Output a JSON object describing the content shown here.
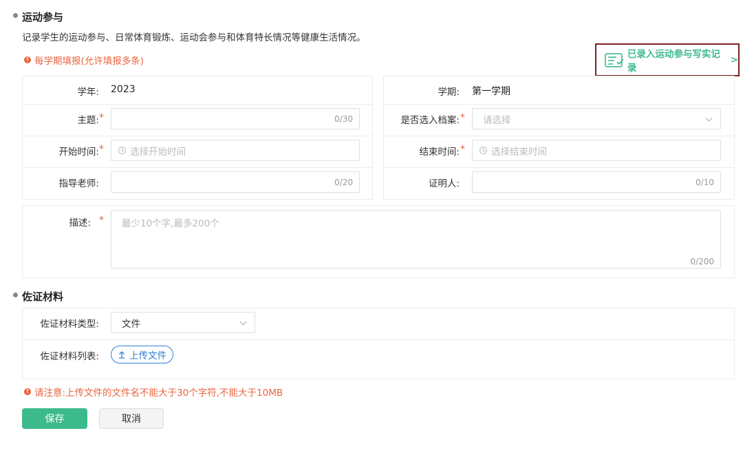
{
  "section1": {
    "title": "运动参与",
    "description": "记录学生的运动参与、日常体育锻炼、运动会参与和体育特长情况等健康生活情况。",
    "notice": "每学期填报(允许填报多条)",
    "record_link": "已录入运动参与写实记录",
    "record_link_arrow": ">"
  },
  "form": {
    "year_label": "学年:",
    "year_value": "2023",
    "term_label": "学期:",
    "term_value": "第一学期",
    "topic_label": "主题:",
    "topic_counter": "0/30",
    "archive_label": "是否选入档案:",
    "archive_placeholder": "请选择",
    "start_label": "开始时间:",
    "start_placeholder": "选择开始时间",
    "end_label": "结束时间:",
    "end_placeholder": "选择结束时间",
    "teacher_label": "指导老师:",
    "teacher_counter": "0/20",
    "witness_label": "证明人:",
    "witness_counter": "0/10",
    "desc_label": "描述:",
    "desc_placeholder": "最少10个字,最多200个",
    "desc_counter": "0/200",
    "required_mark": "*"
  },
  "section2": {
    "title": "佐证材料",
    "type_label": "佐证材料类型:",
    "type_value": "文件",
    "list_label": "佐证材料列表:",
    "upload_label": "上传文件",
    "notice": "请注意:上传文件的文件名不能大于30个字符,不能大于10MB"
  },
  "actions": {
    "save": "保存",
    "cancel": "取消"
  },
  "colors": {
    "accent": "#3dba8c",
    "warning": "#e8663f",
    "link_blue": "#2f7fd8",
    "highlight_border": "#7a1f1f"
  }
}
